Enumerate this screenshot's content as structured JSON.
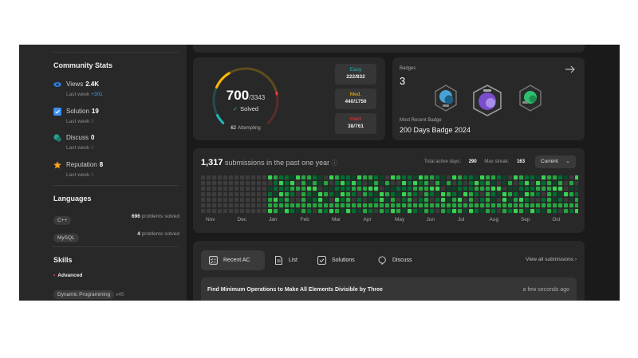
{
  "sidebar": {
    "community_stats": {
      "title": "Community Stats",
      "items": [
        {
          "label": "Views",
          "value": "2.4K",
          "sub_label": "Last week",
          "sub_value": "+301",
          "icon": "eye-icon",
          "color": "#2b7fde"
        },
        {
          "label": "Solution",
          "value": "19",
          "sub_label": "Last week",
          "sub_value": "0",
          "icon": "solution-icon",
          "color": "#3b8ff0"
        },
        {
          "label": "Discuss",
          "value": "0",
          "sub_label": "Last week",
          "sub_value": "0",
          "icon": "discuss-icon",
          "color": "#29a08f"
        },
        {
          "label": "Reputation",
          "value": "8",
          "sub_label": "Last week",
          "sub_value": "0",
          "icon": "star-icon",
          "color": "#ffa116"
        }
      ]
    },
    "languages": {
      "title": "Languages",
      "items": [
        {
          "name": "C++",
          "count": "696",
          "suffix": "problems solved"
        },
        {
          "name": "MySQL",
          "count": "4",
          "suffix": "problems solved"
        }
      ]
    },
    "skills": {
      "title": "Skills",
      "level": "Advanced",
      "items": [
        {
          "name": "Dynamic Programming",
          "count": "x45"
        }
      ]
    }
  },
  "solved": {
    "count": "700",
    "total": "/3343",
    "solved_label": "Solved",
    "attempting_count": "62",
    "attempting_label": "Attempting",
    "difficulties": [
      {
        "label": "Easy",
        "value": "222/832",
        "color": "#1cbaba",
        "solved": 222,
        "total": 832
      },
      {
        "label": "Med.",
        "value": "440/1750",
        "color": "#ffb700",
        "solved": 440,
        "total": 1750
      },
      {
        "label": "Hard",
        "value": "38/761",
        "color": "#f63737",
        "solved": 38,
        "total": 761
      }
    ]
  },
  "badges": {
    "label": "Badges",
    "count": "3",
    "recent_label": "Most Recent Badge",
    "recent_name": "200 Days Badge 2024",
    "items": [
      {
        "icon": "annual-badge-icon",
        "color": "#4aa3d8"
      },
      {
        "icon": "200-days-badge-icon",
        "color": "#7a4dcc"
      },
      {
        "icon": "50-days-badge-icon",
        "color": "#2fbf6f"
      }
    ]
  },
  "heatmap": {
    "count": "1,317",
    "text": "submissions in the past one year",
    "active_label": "Total active days:",
    "active_value": "290",
    "streak_label": "Max streak:",
    "streak_value": "163",
    "select_value": "Current",
    "months": [
      "Nov",
      "Dec",
      "Jan",
      "Feb",
      "Mar",
      "Apr",
      "May",
      "Jun",
      "Jul",
      "Aug",
      "Sep",
      "Oct"
    ],
    "colors": {
      "empty": "#3a3a3a",
      "l1": "#0e4429",
      "l2": "#006d32",
      "l3": "#26a641",
      "l4": "#39d353"
    }
  },
  "submissions": {
    "tabs": [
      {
        "label": "Recent AC",
        "icon": "recent-ac-icon"
      },
      {
        "label": "List",
        "icon": "list-icon"
      },
      {
        "label": "Solutions",
        "icon": "solutions-icon"
      },
      {
        "label": "Discuss",
        "icon": "discuss-icon"
      }
    ],
    "view_all": "View all submissions",
    "rows": [
      {
        "title": "Find Minimum Operations to Make All Elements Divisible by Three",
        "time": "a few seconds ago"
      }
    ]
  }
}
